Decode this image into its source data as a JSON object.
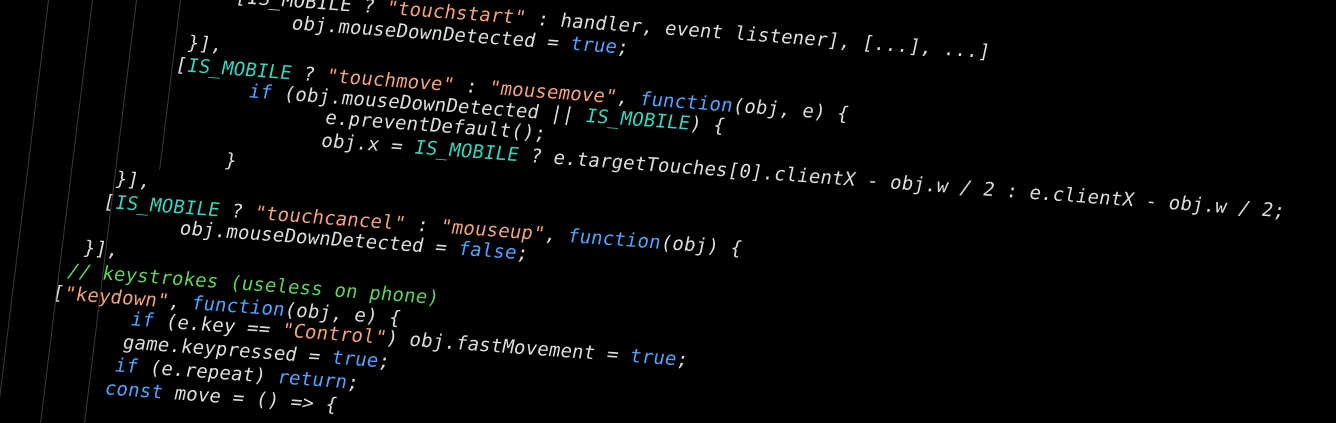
{
  "editor": {
    "colors": {
      "background": "#000000",
      "keyword": "#4fa3ff",
      "string": "#f2a27a",
      "constant": "#3ad1bf",
      "comment": "#5bd35a",
      "text": "#dcdcdc",
      "guide": "#3a3a3a"
    },
    "lines": [
      {
        "tokens": [
          {
            "t": "plain",
            "v": "[IS_MOBILE ? "
          },
          {
            "t": "str",
            "v": "\"touchstart\""
          },
          {
            "t": "plain",
            "v": " : handler, event listener], [...], ...]"
          }
        ]
      },
      {
        "tokens": [
          {
            "t": "plain",
            "v": "    obj.mouseDownDetected = "
          },
          {
            "t": "bool",
            "v": "true"
          },
          {
            "t": "plain",
            "v": ";"
          }
        ]
      },
      {
        "tokens": [
          {
            "t": "plain",
            "v": "}],"
          }
        ]
      },
      {
        "tokens": [
          {
            "t": "plain",
            "v": "["
          },
          {
            "t": "const",
            "v": "IS_MOBILE"
          },
          {
            "t": "plain",
            "v": " ? "
          },
          {
            "t": "str",
            "v": "\"touchmove\""
          },
          {
            "t": "plain",
            "v": " : "
          },
          {
            "t": "str",
            "v": "\"mousemove\""
          },
          {
            "t": "plain",
            "v": ", "
          },
          {
            "t": "kw",
            "v": "function"
          },
          {
            "t": "plain",
            "v": "(obj, e) {"
          }
        ]
      },
      {
        "tokens": [
          {
            "t": "plain",
            "v": "    "
          },
          {
            "t": "kw",
            "v": "if"
          },
          {
            "t": "plain",
            "v": " (obj.mouseDownDetected || "
          },
          {
            "t": "const",
            "v": "IS_MOBILE"
          },
          {
            "t": "plain",
            "v": ") {"
          }
        ]
      },
      {
        "tokens": [
          {
            "t": "plain",
            "v": "        e.preventDefault();"
          }
        ]
      },
      {
        "tokens": [
          {
            "t": "plain",
            "v": "        obj.x = "
          },
          {
            "t": "const",
            "v": "IS_MOBILE"
          },
          {
            "t": "plain",
            "v": " ? e.targetTouches[0].clientX - obj.w / 2 : e.clientX - obj.w / 2;"
          }
        ]
      },
      {
        "tokens": [
          {
            "t": "plain",
            "v": "    }"
          }
        ]
      },
      {
        "tokens": [
          {
            "t": "plain",
            "v": "}],"
          }
        ]
      },
      {
        "tokens": [
          {
            "t": "plain",
            "v": "["
          },
          {
            "t": "const",
            "v": "IS_MOBILE"
          },
          {
            "t": "plain",
            "v": " ? "
          },
          {
            "t": "str",
            "v": "\"touchcancel\""
          },
          {
            "t": "plain",
            "v": " : "
          },
          {
            "t": "str",
            "v": "\"mouseup\""
          },
          {
            "t": "plain",
            "v": ", "
          },
          {
            "t": "kw",
            "v": "function"
          },
          {
            "t": "plain",
            "v": "(obj) {"
          }
        ]
      },
      {
        "tokens": [
          {
            "t": "plain",
            "v": "    obj.mouseDownDetected = "
          },
          {
            "t": "bool",
            "v": "false"
          },
          {
            "t": "plain",
            "v": ";"
          }
        ]
      },
      {
        "tokens": [
          {
            "t": "plain",
            "v": "}],"
          }
        ]
      },
      {
        "tokens": [
          {
            "t": "comment",
            "v": "// keystrokes (useless on phone)"
          }
        ]
      },
      {
        "tokens": [
          {
            "t": "plain",
            "v": "["
          },
          {
            "t": "str",
            "v": "\"keydown\""
          },
          {
            "t": "plain",
            "v": ", "
          },
          {
            "t": "kw",
            "v": "function"
          },
          {
            "t": "plain",
            "v": "(obj, e) {"
          }
        ]
      },
      {
        "tokens": [
          {
            "t": "plain",
            "v": "    "
          },
          {
            "t": "kw",
            "v": "if"
          },
          {
            "t": "plain",
            "v": " (e.key == "
          },
          {
            "t": "str",
            "v": "\"Control\""
          },
          {
            "t": "plain",
            "v": ") obj.fastMovement = "
          },
          {
            "t": "bool",
            "v": "true"
          },
          {
            "t": "plain",
            "v": ";"
          }
        ]
      },
      {
        "tokens": [
          {
            "t": "plain",
            "v": "    game.keypressed = "
          },
          {
            "t": "bool",
            "v": "true"
          },
          {
            "t": "plain",
            "v": ";"
          }
        ]
      },
      {
        "tokens": [
          {
            "t": "plain",
            "v": "    "
          },
          {
            "t": "kw",
            "v": "if"
          },
          {
            "t": "plain",
            "v": " (e.repeat) "
          },
          {
            "t": "kw",
            "v": "return"
          },
          {
            "t": "plain",
            "v": ";"
          }
        ]
      },
      {
        "tokens": [
          {
            "t": "plain",
            "v": "    "
          },
          {
            "t": "kw",
            "v": "const"
          },
          {
            "t": "plain",
            "v": " move = () => {"
          }
        ]
      }
    ]
  }
}
